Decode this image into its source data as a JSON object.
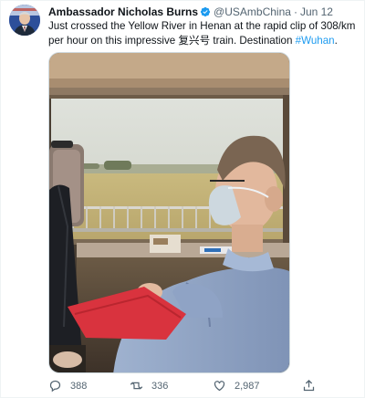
{
  "tweet": {
    "author": {
      "display_name": "Ambassador Nicholas Burns",
      "handle": "@USAmbChina",
      "verified": true,
      "avatar_icon": "profile-photo"
    },
    "separator": "·",
    "time": "Jun 12",
    "text_before": "Just crossed the Yellow River in Henan at the rapid clip of 308/km per hour on this impressive 复兴号 train.  Destination ",
    "hashtag": "#Wuhan",
    "text_after": ".",
    "photo": {
      "alt_icon": "train-window-photo"
    },
    "actions": {
      "reply_count": "388",
      "retweet_count": "336",
      "like_count": "2,987"
    }
  },
  "colors": {
    "link": "#1d9bf0",
    "secondary_text": "#536471",
    "verified_badge": "#1d9bf0"
  }
}
